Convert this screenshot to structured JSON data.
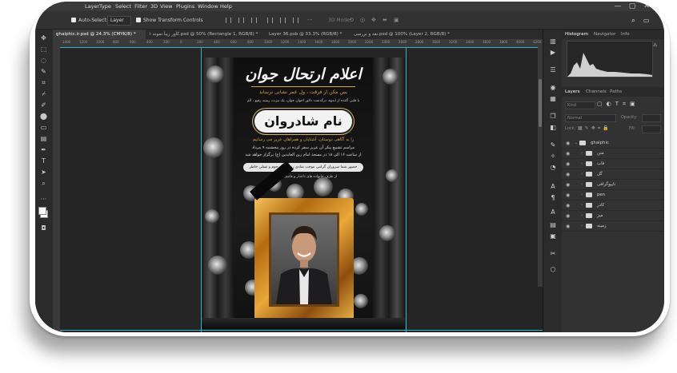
{
  "menu": {
    "items": [
      "Layer",
      "Type",
      "Select",
      "Filter",
      "3D",
      "View",
      "Plugins",
      "Window",
      "Help"
    ]
  },
  "window_controls": {
    "minimize": "—",
    "maximize": "▢",
    "close": "✕"
  },
  "options_bar": {
    "auto_select_label": "Auto-Select:",
    "layer_dropdown": "Layer",
    "show_transform_label": "Show Transform Controls",
    "mode_3d_label": "3D Mode:"
  },
  "doc_tabs": [
    {
      "label": "ghalphic.ir.psd @ 24.3% (CMYK/8) *",
      "active": true
    },
    {
      "label": "کاور زیبا نمونه ۱.psd @ 50% (Rectangle 1, RGB/8) *",
      "active": false
    },
    {
      "label": "Layer 36.psb @ 33.3% (RGB/8) *",
      "active": false
    },
    {
      "label": "نقد و بررسی.psd @ 100% (Layer 2, RGB/8) *",
      "active": false
    }
  ],
  "ruler_ticks": [
    "1400",
    "1200",
    "1000",
    "800",
    "600",
    "400",
    "200",
    "0",
    "200",
    "400",
    "600",
    "800",
    "1000",
    "1200",
    "1400",
    "1600",
    "1800",
    "2000",
    "2200",
    "2400",
    "2600",
    "2800",
    "3000",
    "3200",
    "3400",
    "3600",
    "3800",
    "4000",
    "4200"
  ],
  "poster": {
    "title": "اعلام ارتحال جوان",
    "verse": "بس مکن از فرقت ، ول عمر نشانی نرساند",
    "line1": "با قلبی آکنده از اندوه، درگذشت دلاور اخوان جوان، یک تیرت، رسته رفیع ، الم",
    "name": "نام شادروان",
    "line2": "را به آگاهی دوستان، آشنایان و همراهان عزیز می رسانیم",
    "line3": "مراسم تشییع پیکر آن عزیز سفر کرده در روز پنجشنبه ۹ مرداد",
    "line4": "از ساعت ۱۶ الی ۱۸ در مسجد امام زین العابدین (ع) برگزار خواهد شد",
    "pill_text": "حضور شما سروران گرامی موجب شادی روح آن مرحوم و تسلی خاطر بازماندگان خواهد بود",
    "footer": "از طرف خانواده های داغدار و فامیل و بستگان"
  },
  "panel": {
    "tabs_top": [
      {
        "label": "Histogram",
        "active": true
      },
      {
        "label": "Navigator",
        "active": false
      },
      {
        "label": "Info",
        "active": false
      }
    ],
    "tabs_layers": [
      {
        "label": "Layers",
        "active": true
      },
      {
        "label": "Channels",
        "active": false
      },
      {
        "label": "Paths",
        "active": false
      }
    ],
    "filter_kind": "Kind",
    "blend_mode": "Normal",
    "opacity_label": "Opacity:",
    "lock_label": "Lock:",
    "fill_label": "Fill:",
    "group_root": "ghalphic",
    "layers": [
      "متن",
      "قاب",
      "گل",
      "تایپوگرافی",
      "pen",
      "کادر",
      "میز",
      "زمینه"
    ]
  },
  "colors": {
    "app_bg": "#262626",
    "panel_bg": "#323232",
    "guide": "#2fb0d0",
    "gold": "#d9a040"
  }
}
